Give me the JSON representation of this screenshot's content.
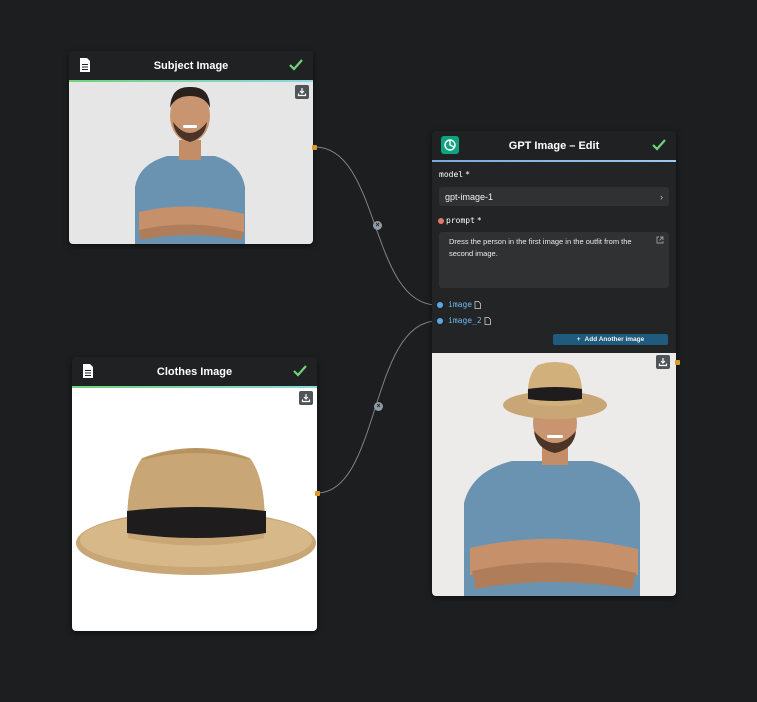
{
  "nodes": {
    "subject": {
      "title": "Subject Image",
      "image_alt": "Man in blue t-shirt with arms crossed"
    },
    "clothes": {
      "title": "Clothes Image",
      "image_alt": "Straw fedora hat with black band"
    },
    "gpt": {
      "title": "GPT Image – Edit",
      "model_label": "model",
      "model_value": "gpt-image-1",
      "prompt_label": "prompt",
      "prompt_value": "Dress the person in the first image in the outfit from the second image.",
      "required_mark": "*",
      "input_image": "image",
      "input_image_2": "image_2",
      "add_button": "Add Another image",
      "output_alt": "Man wearing straw hat and blue t-shirt"
    }
  },
  "colors": {
    "canvas": "#1c1e1f",
    "node": "#232426",
    "accent_blue": "#1e5b7e",
    "port_orange": "#d99a2c",
    "check_green": "#6fd27a"
  },
  "icons": [
    "document-icon",
    "check-icon",
    "download-icon",
    "openai-icon",
    "external-link-icon",
    "file-icon",
    "plus-icon",
    "close-icon"
  ]
}
